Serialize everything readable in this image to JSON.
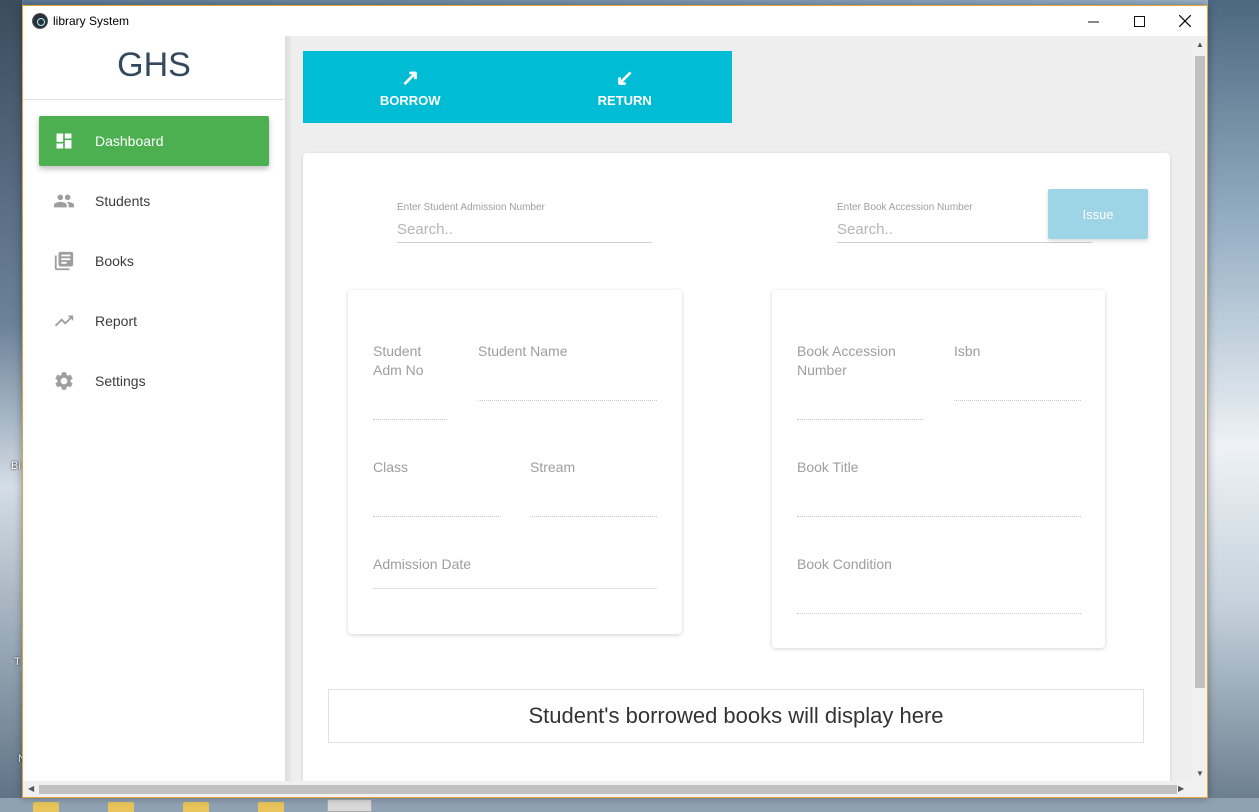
{
  "window": {
    "title": "library System"
  },
  "desktop": {
    "labels": [
      "Bi",
      "T",
      "N"
    ]
  },
  "sidebar": {
    "brand": "GHS",
    "items": [
      {
        "label": "Dashboard",
        "icon": "dashboard-icon",
        "active": true
      },
      {
        "label": "Students",
        "icon": "people-icon",
        "active": false
      },
      {
        "label": "Books",
        "icon": "library-books-icon",
        "active": false
      },
      {
        "label": "Report",
        "icon": "trending-up-icon",
        "active": false
      },
      {
        "label": "Settings",
        "icon": "gear-icon",
        "active": false
      }
    ]
  },
  "toggle": {
    "borrow_label": "BORROW",
    "return_label": "RETURN",
    "color": "#00bcd4"
  },
  "search": {
    "student_label": "Enter Student Admission Number",
    "student_placeholder": "Search..",
    "book_label": "Enter Book Accession Number",
    "book_placeholder": "Search..",
    "issue_label": "Issue"
  },
  "student_card": {
    "adm_no_label": "Student\nAdm No",
    "name_label": "Student Name",
    "class_label": "Class",
    "stream_label": "Stream",
    "admission_date_label": "Admission Date"
  },
  "book_card": {
    "accession_label": "Book Accession\nNumber",
    "isbn_label": "Isbn",
    "title_label": "Book Title",
    "condition_label": "Book Condition"
  },
  "borrowed": {
    "message": "Student's borrowed books will display here"
  },
  "colors": {
    "accent_green": "#4caf50",
    "accent_cyan": "#00bcd4",
    "issue_button": "#9dd5e6"
  }
}
